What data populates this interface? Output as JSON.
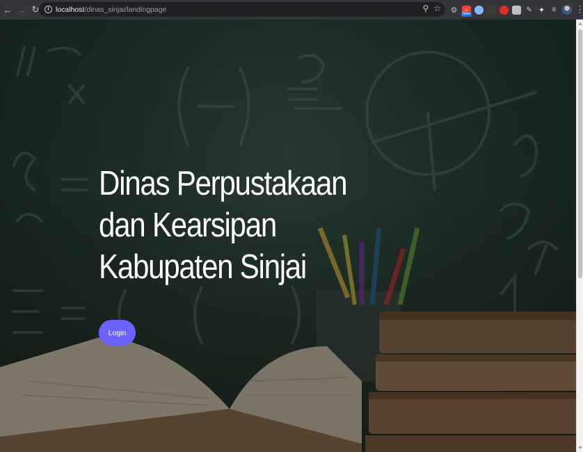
{
  "browser": {
    "url_host": "localhost",
    "url_path": "/dinas_sinjai/landingpage",
    "extensions": [
      {
        "name": "gear-extension-icon",
        "color": "#9aa0a6"
      },
      {
        "name": "lock-extension-icon",
        "color": "#e8453c",
        "badge": "New"
      },
      {
        "name": "translate-extension-icon",
        "color": "#8ab4f8"
      },
      {
        "name": "dark-extension-icon",
        "color": "#3c3c3c"
      },
      {
        "name": "red-extension-icon",
        "color": "#d93025"
      },
      {
        "name": "clipboard-extension-icon",
        "color": "#bdc1c6"
      },
      {
        "name": "puzzle-icon",
        "color": "#c4c7c5"
      },
      {
        "name": "reading-list-icon",
        "color": "#c4c7c5"
      }
    ]
  },
  "hero": {
    "title": "Dinas Perpustakaan dan Kearsipan Kabupaten Sinjai",
    "login_label": "Login"
  },
  "colors": {
    "accent": "#6c63ff",
    "chalkboard": "#2c463b"
  }
}
